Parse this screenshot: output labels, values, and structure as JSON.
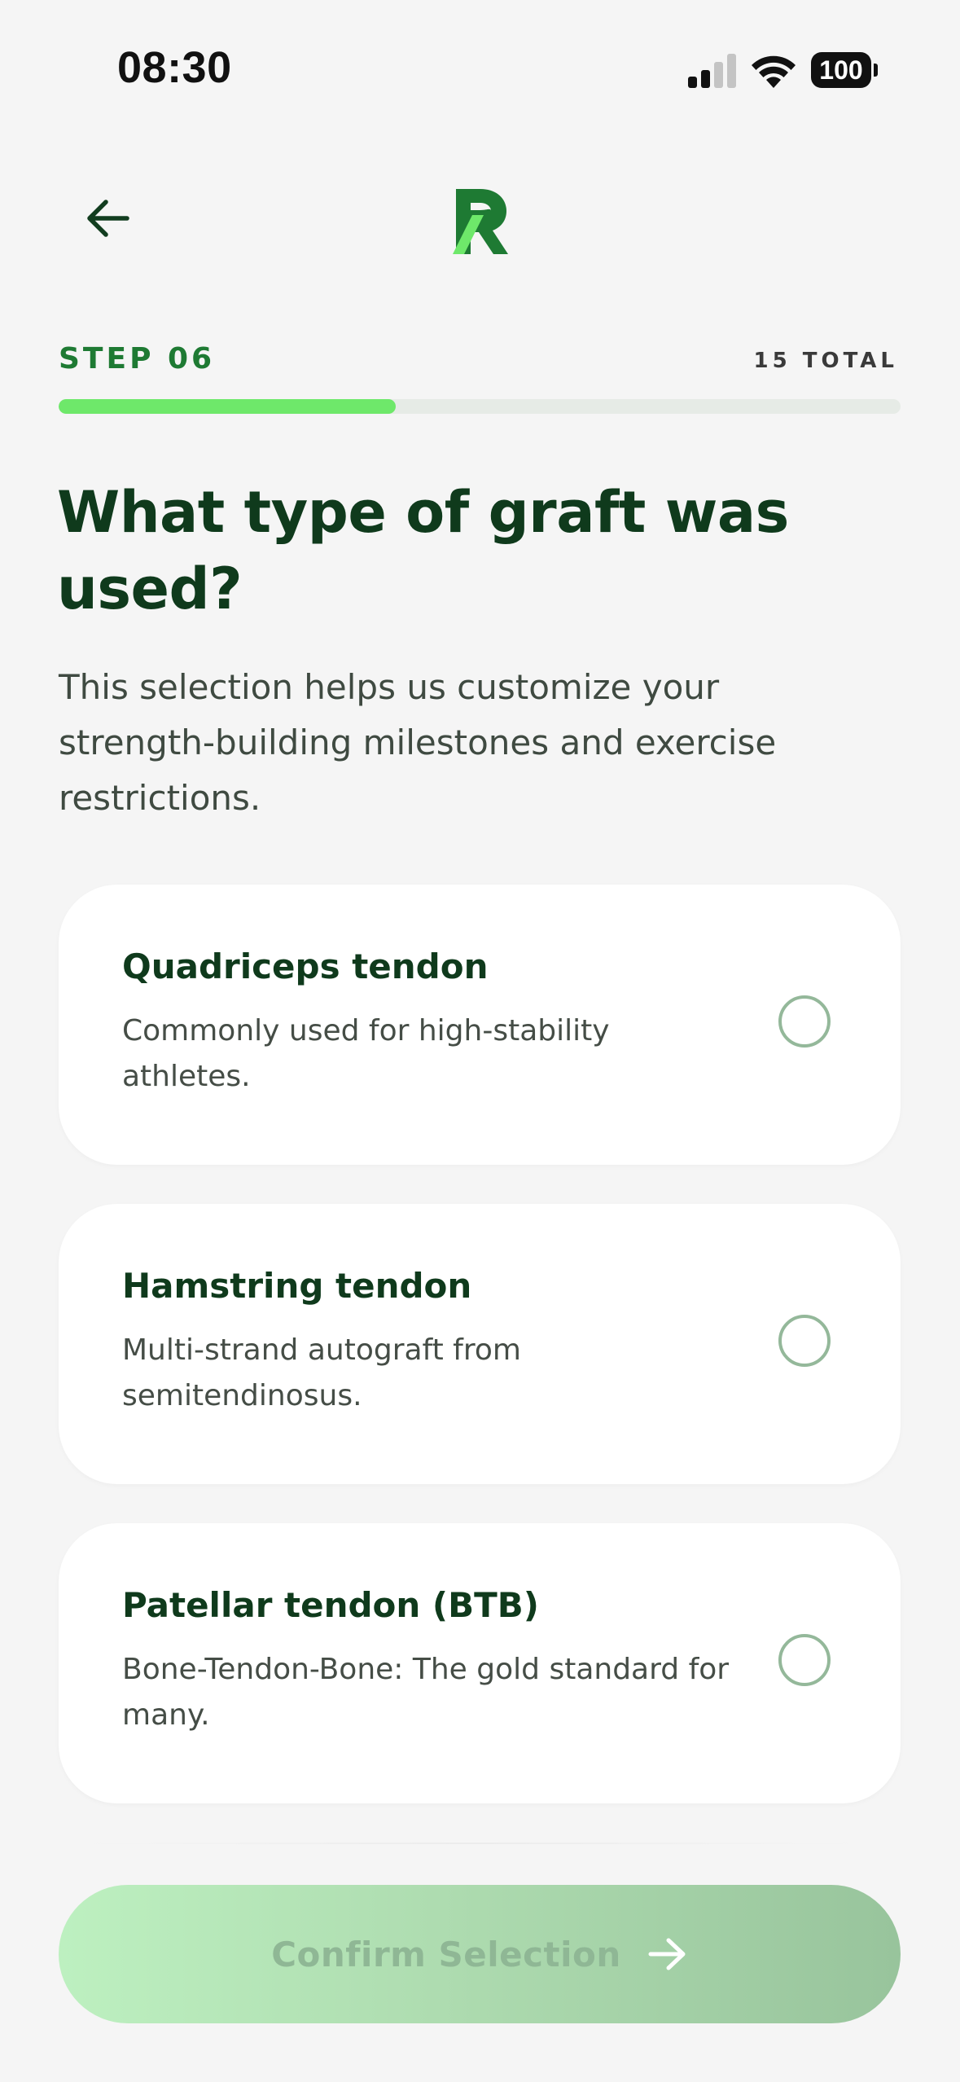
{
  "status_bar": {
    "time": "08:30",
    "battery": "100"
  },
  "header": {
    "logo_letter": "R"
  },
  "step": {
    "label": "STEP 06",
    "total": "15 TOTAL",
    "progress": 0.4
  },
  "question": {
    "title": "What type of graft was used?",
    "subtitle": "This selection helps us customize your strength-building milestones and exercise restrictions."
  },
  "options": [
    {
      "title": "Quadriceps tendon",
      "description": "Commonly used for high-stability athletes.",
      "selected": false
    },
    {
      "title": "Hamstring tendon",
      "description": "Multi-strand autograft from semitendinosus.",
      "selected": false
    },
    {
      "title": "Patellar tendon (BTB)",
      "description": "Bone-Tendon-Bone: The gold standard for many.",
      "selected": false
    }
  ],
  "confirm": {
    "label": "Confirm Selection"
  },
  "colors": {
    "accent": "#6ee86a",
    "brand_dark": "#1e7a33",
    "title": "#0f3a1c",
    "background": "#f5f5f5"
  },
  "icons": {
    "back": "arrow-left-icon",
    "confirm": "arrow-right-icon",
    "signal": "cellular-signal-icon",
    "wifi": "wifi-icon",
    "battery": "battery-icon"
  }
}
